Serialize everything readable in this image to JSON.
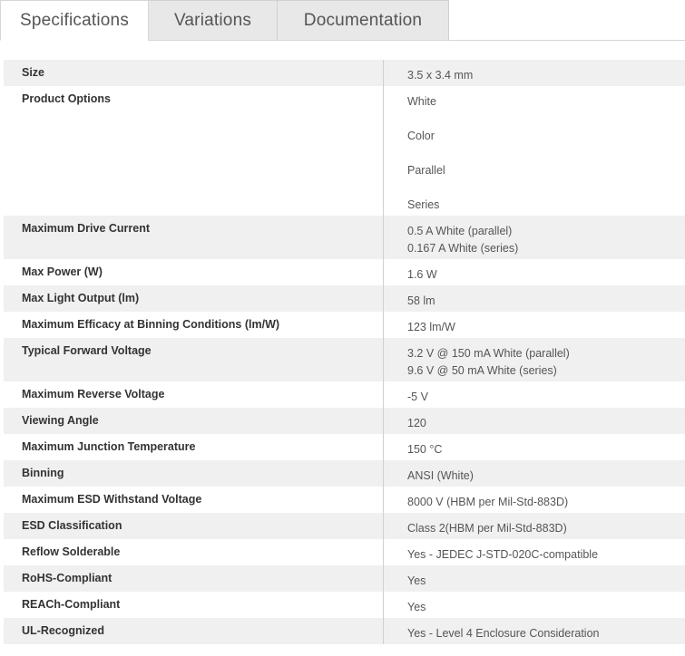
{
  "tabs": [
    {
      "label": "Specifications",
      "active": true
    },
    {
      "label": "Variations",
      "active": false
    },
    {
      "label": "Documentation",
      "active": false
    }
  ],
  "specs": [
    {
      "label": "Size",
      "values": [
        "3.5 x 3.4 mm"
      ]
    },
    {
      "label": "Product Options",
      "values": [
        "White",
        "Color",
        "Parallel",
        "Series"
      ]
    },
    {
      "label": "Maximum Drive Current",
      "values": [
        "0.5 A White (parallel)",
        "0.167 A White (series)"
      ]
    },
    {
      "label": "Max Power (W)",
      "values": [
        "1.6 W"
      ]
    },
    {
      "label": "Max Light Output (lm)",
      "values": [
        "58 lm"
      ]
    },
    {
      "label": "Maximum Efficacy at Binning Conditions (lm/W)",
      "values": [
        "123 lm/W"
      ]
    },
    {
      "label": "Typical Forward Voltage",
      "values": [
        "3.2 V @ 150 mA White (parallel)",
        "9.6 V @ 50 mA White (series)"
      ]
    },
    {
      "label": "Maximum Reverse Voltage",
      "values": [
        "-5 V"
      ]
    },
    {
      "label": "Viewing Angle",
      "values": [
        "120"
      ]
    },
    {
      "label": "Maximum Junction Temperature",
      "values": [
        "150 °C"
      ]
    },
    {
      "label": "Binning",
      "values": [
        "ANSI (White)"
      ]
    },
    {
      "label": "Maximum ESD Withstand Voltage",
      "values": [
        "8000 V (HBM per Mil-Std-883D)"
      ]
    },
    {
      "label": "ESD Classification",
      "values": [
        "Class 2(HBM per Mil-Std-883D)"
      ]
    },
    {
      "label": "Reflow Solderable",
      "values": [
        "Yes - JEDEC J-STD-020C-compatible"
      ]
    },
    {
      "label": "RoHS-Compliant",
      "values": [
        "Yes"
      ]
    },
    {
      "label": "REACh-Compliant",
      "values": [
        "Yes"
      ]
    },
    {
      "label": "UL-Recognized",
      "values": [
        "Yes - Level 4 Enclosure Consideration"
      ]
    }
  ]
}
